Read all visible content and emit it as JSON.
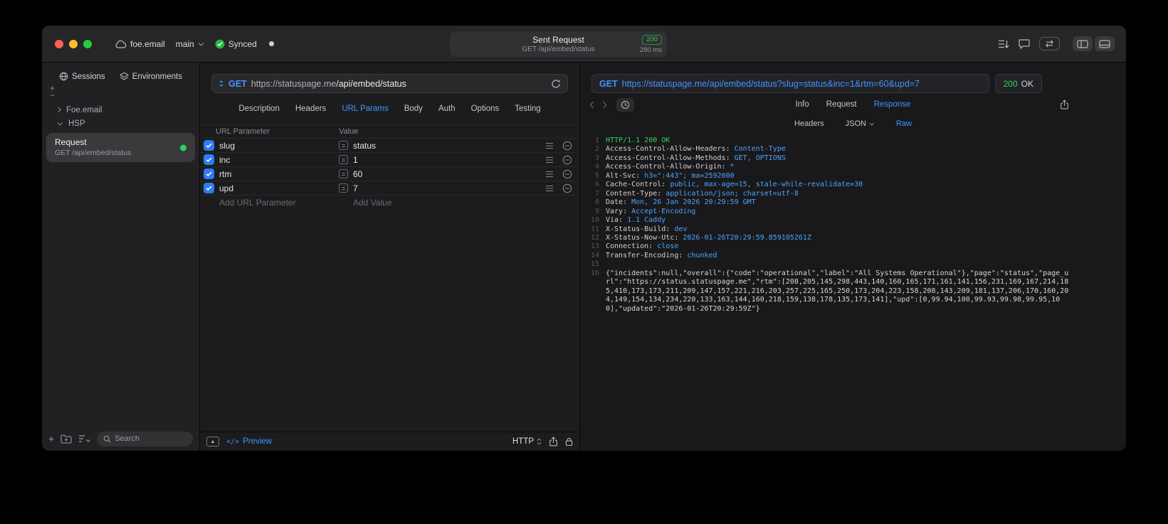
{
  "colors": {
    "accent_blue": "#4094ff",
    "success_green": "#30d158",
    "method_blue": "#4094ff"
  },
  "icons": {
    "equals_glyph": "=",
    "expand_glyph": "▲",
    "plus_glyph": "+",
    "minus_glyph": "−"
  },
  "titlebar": {
    "project": "foe.email",
    "branch": "main",
    "sync": "Synced",
    "title": "Sent Request",
    "subtitle": "GET /api/embed/status",
    "status_code": "200",
    "duration": "280 ms"
  },
  "sidebar": {
    "tabs": [
      {
        "label": "Sessions"
      },
      {
        "label": "Environments"
      }
    ],
    "tree": [
      {
        "label": "Foe.email"
      },
      {
        "label": "HSP"
      }
    ],
    "selected": {
      "title": "Request",
      "subtitle": "GET /api/embed/status"
    },
    "search_placeholder": "Search"
  },
  "request": {
    "method": "GET",
    "url_base": "https://statuspage.me",
    "url_path": "/api/embed/status",
    "tabs": [
      "Description",
      "Headers",
      "URL Params",
      "Body",
      "Auth",
      "Options",
      "Testing"
    ],
    "active_tab": "URL Params",
    "table": {
      "col_param": "URL Parameter",
      "col_value": "Value",
      "rows": [
        {
          "name": "slug",
          "value": "status",
          "enabled": true
        },
        {
          "name": "inc",
          "value": "1",
          "enabled": true
        },
        {
          "name": "rtm",
          "value": "60",
          "enabled": true
        },
        {
          "name": "upd",
          "value": "7",
          "enabled": true
        }
      ],
      "add_param": "Add URL Parameter",
      "add_value": "Add Value"
    },
    "footer": {
      "code_glyph": "</>",
      "preview": "Preview",
      "protocol": "HTTP"
    }
  },
  "response": {
    "method": "GET",
    "url": "https://statuspage.me/api/embed/status?slug=status&inc=1&rtm=60&upd=7",
    "status_code": "200",
    "status_text": "OK",
    "tabs": [
      "Info",
      "Request",
      "Response"
    ],
    "active_tab": "Response",
    "subtabs": [
      "Headers",
      "JSON",
      "Raw"
    ],
    "active_subtab": "Raw",
    "lines": [
      {
        "no": "1",
        "text": "HTTP/1.1 200 OK"
      },
      {
        "no": "2",
        "name": "Access-Control-Allow-Headers: ",
        "value": "Content-Type"
      },
      {
        "no": "3",
        "name": "Access-Control-Allow-Methods: ",
        "value": "GET, OPTIONS"
      },
      {
        "no": "4",
        "name": "Access-Control-Allow-Origin: ",
        "value": "*"
      },
      {
        "no": "5",
        "name": "Alt-Svc: ",
        "value": "h3=\":443\"; ma=2592000"
      },
      {
        "no": "6",
        "name": "Cache-Control: ",
        "value": "public, max-age=15, stale-while-revalidate=30"
      },
      {
        "no": "7",
        "name": "Content-Type: ",
        "value": "application/json; charset=utf-8"
      },
      {
        "no": "8",
        "name": "Date: ",
        "value": "Mon, 26 Jan 2026 20:29:59 GMT"
      },
      {
        "no": "9",
        "name": "Vary: ",
        "value": "Accept-Encoding"
      },
      {
        "no": "10",
        "name": "Via: ",
        "value": "1.1 Caddy"
      },
      {
        "no": "11",
        "name": "X-Status-Build: ",
        "value": "dev"
      },
      {
        "no": "12",
        "name": "X-Status-Now-Utc: ",
        "value": "2026-01-26T20:29:59.859105261Z"
      },
      {
        "no": "13",
        "name": "Connection: ",
        "value": "close"
      },
      {
        "no": "14",
        "name": "Transfer-Encoding: ",
        "value": "chunked"
      },
      {
        "no": "15"
      },
      {
        "no": "16",
        "body": "{\"incidents\":null,\"overall\":{\"code\":\"operational\",\"label\":\"All Systems Operational\"},\"page\":\"status\",\"page_url\":\"https://status.statuspage.me\",\"rtm\":[208,205,145,298,443,140,160,165,171,161,141,156,231,169,167,214,185,410,173,173,211,209,147,157,221,216,203,257,225,165,250,173,204,223,158,208,143,209,181,137,206,170,160,204,149,154,134,234,220,133,163,144,160,218,159,138,178,135,173,141],\"upd\":[0,99.94,100,99.93,99.98,99.95,100],\"updated\":\"2026-01-26T20:29:59Z\"}"
      }
    ]
  }
}
